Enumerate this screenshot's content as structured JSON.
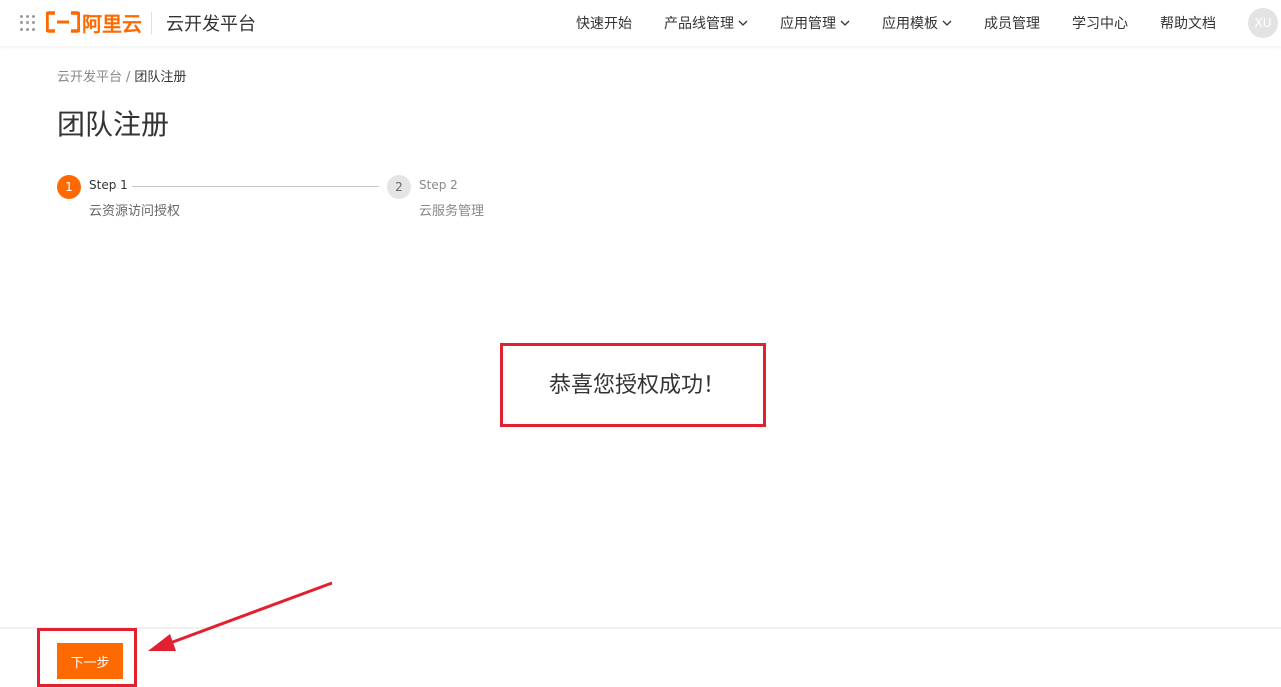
{
  "header": {
    "logo_text": "阿里云",
    "platform_title": "云开发平台",
    "nav": [
      {
        "label": "快速开始",
        "has_dropdown": false
      },
      {
        "label": "产品线管理",
        "has_dropdown": true
      },
      {
        "label": "应用管理",
        "has_dropdown": true
      },
      {
        "label": "应用模板",
        "has_dropdown": true
      },
      {
        "label": "成员管理",
        "has_dropdown": false
      },
      {
        "label": "学习中心",
        "has_dropdown": false
      },
      {
        "label": "帮助文档",
        "has_dropdown": false
      }
    ],
    "avatar_text": "XU"
  },
  "breadcrumb": {
    "root": "云开发平台",
    "separator": "/",
    "current": "团队注册"
  },
  "page_title": "团队注册",
  "steps": [
    {
      "number": "1",
      "title": "Step 1",
      "description": "云资源访问授权",
      "status": "active"
    },
    {
      "number": "2",
      "title": "Step 2",
      "description": "云服务管理",
      "status": "pending"
    }
  ],
  "success_message": "恭喜您授权成功！",
  "footer": {
    "next_label": "下一步"
  },
  "colors": {
    "brand": "#ff6a00",
    "annotation_red": "#e3202f"
  }
}
